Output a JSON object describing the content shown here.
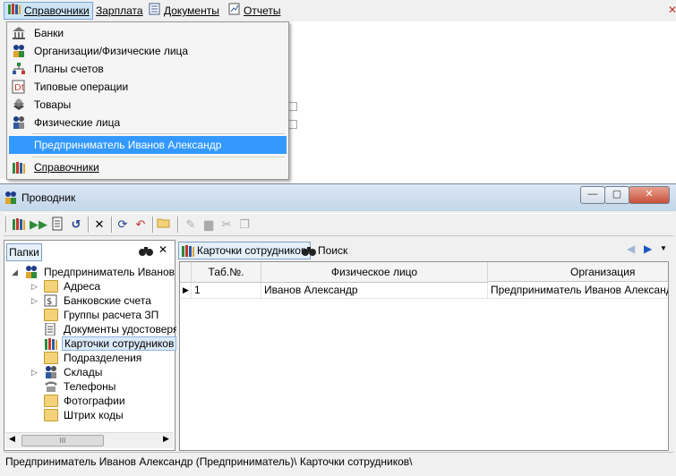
{
  "menubar": {
    "items": [
      {
        "label": "Справочники",
        "icon": "books-icon"
      },
      {
        "label": "Зарплата",
        "icon": ""
      },
      {
        "label": "Документы",
        "icon": "document-icon"
      },
      {
        "label": "Отчеты",
        "icon": "report-icon"
      }
    ]
  },
  "dropdown": {
    "items": [
      {
        "label": "Банки",
        "icon": "bank-icon"
      },
      {
        "label": "Организации/Физические лица",
        "icon": "people-icon"
      },
      {
        "label": "Планы счетов",
        "icon": "chart-of-accounts-icon"
      },
      {
        "label": "Типовые операции",
        "icon": "operations-icon"
      },
      {
        "label": "Товары",
        "icon": "goods-icon"
      },
      {
        "label": "Физические лица",
        "icon": "person-icon"
      },
      {
        "label": "Предприниматель Иванов Александр",
        "icon": "",
        "highlighted": true
      },
      {
        "label": "Справочники",
        "icon": "books-icon"
      }
    ]
  },
  "window": {
    "title": "Проводник",
    "minimize": "—",
    "maximize": "▢",
    "close": "✕"
  },
  "leftpane": {
    "tab": "Папки",
    "tree": [
      {
        "label": "Предприниматель Иванов А",
        "icon": "people-icon",
        "toggle": "◢",
        "level": 0
      },
      {
        "label": "Адреса",
        "icon": "folder-icon",
        "toggle": "▷",
        "level": 1
      },
      {
        "label": "Банковские счета",
        "icon": "bank-account-icon",
        "toggle": "▷",
        "level": 1
      },
      {
        "label": "Группы расчета ЗП",
        "icon": "folder-icon",
        "toggle": "",
        "level": 1
      },
      {
        "label": "Документы удостоверя",
        "icon": "document-icon",
        "toggle": "",
        "level": 1
      },
      {
        "label": "Карточки сотрудников",
        "icon": "books-icon",
        "toggle": "",
        "level": 1,
        "selected": true
      },
      {
        "label": "Подразделения",
        "icon": "folder-icon",
        "toggle": "",
        "level": 1
      },
      {
        "label": "Склады",
        "icon": "warehouse-icon",
        "toggle": "▷",
        "level": 1
      },
      {
        "label": "Телефоны",
        "icon": "phone-icon",
        "toggle": "",
        "level": 1
      },
      {
        "label": "Фотографии",
        "icon": "folder-icon",
        "toggle": "",
        "level": 1
      },
      {
        "label": "Штрих коды",
        "icon": "folder-icon",
        "toggle": "",
        "level": 1
      }
    ],
    "scroll_thumb": "III"
  },
  "rightpane": {
    "tab_cards": "Карточки сотрудников",
    "tab_search": "Поиск",
    "columns": [
      "Таб.№.",
      "Физическое лицо",
      "Организация"
    ],
    "rows": [
      {
        "tab_no": "1",
        "person": "Иванов Александр",
        "org": "Предприниматель Иванов Александр"
      }
    ]
  },
  "statusbar": {
    "text": "Предприниматель Иванов Александр (Предприниматель)\\ Карточки сотрудников\\"
  },
  "colors": {
    "highlight": "#3399ff",
    "titlebar": "#c4d6eb",
    "close_button": "#c7503a"
  }
}
